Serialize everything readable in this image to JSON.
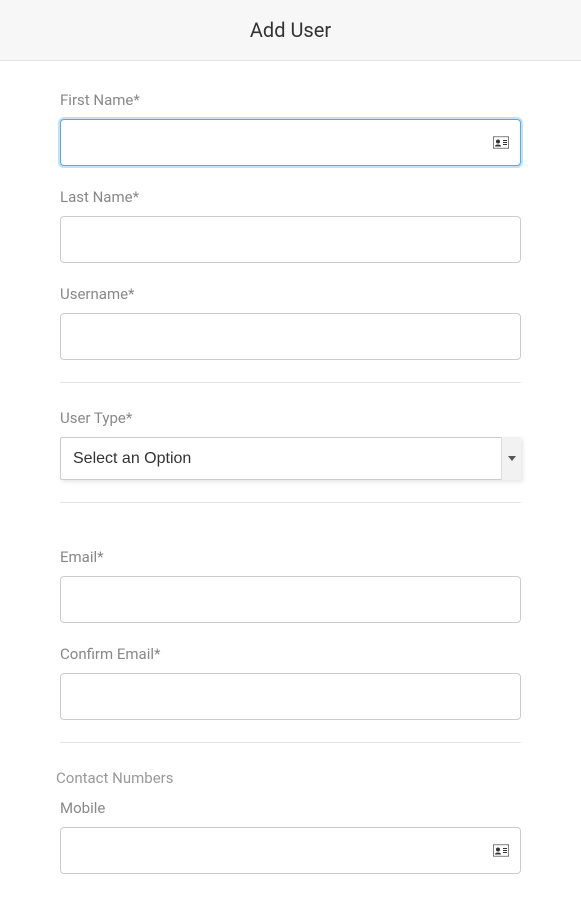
{
  "header": {
    "title": "Add User"
  },
  "form": {
    "firstName": {
      "label": "First Name*",
      "value": ""
    },
    "lastName": {
      "label": "Last Name*",
      "value": ""
    },
    "username": {
      "label": "Username*",
      "value": ""
    },
    "userType": {
      "label": "User Type*",
      "selected": "Select an Option"
    },
    "email": {
      "label": "Email*",
      "value": ""
    },
    "confirmEmail": {
      "label": "Confirm Email*",
      "value": ""
    },
    "contactSection": {
      "title": "Contact Numbers"
    },
    "mobile": {
      "label": "Mobile",
      "value": ""
    }
  }
}
